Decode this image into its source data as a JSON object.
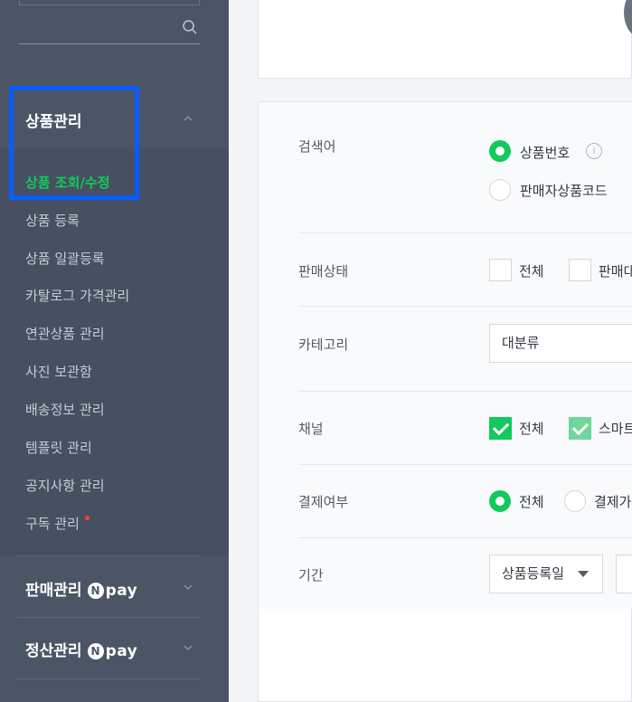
{
  "sidebar": {
    "sections": [
      {
        "title": "상품관리",
        "expanded": true,
        "items": [
          {
            "label": "상품 조회/수정",
            "active": true
          },
          {
            "label": "상품 등록"
          },
          {
            "label": "상품 일괄등록"
          },
          {
            "label": "카탈로그 가격관리"
          },
          {
            "label": "연관상품 관리"
          },
          {
            "label": "사진 보관함"
          },
          {
            "label": "배송정보 관리"
          },
          {
            "label": "템플릿 관리"
          },
          {
            "label": "공지사항 관리"
          },
          {
            "label": "구독 관리",
            "badge": "red-dot"
          }
        ]
      },
      {
        "title": "판매관리",
        "badge_n": "N",
        "badge_text": "pay",
        "expanded": false
      },
      {
        "title": "정산관리",
        "badge_n": "N",
        "badge_text": "pay",
        "expanded": false
      }
    ]
  },
  "form": {
    "search_term": {
      "label": "검색어",
      "options": [
        {
          "label": "상품번호",
          "selected": true,
          "info_icon": "i"
        },
        {
          "label": "판매자상품코드",
          "selected": false
        }
      ]
    },
    "sale_status": {
      "label": "판매상태",
      "options": [
        {
          "label": "전체",
          "checked": false
        },
        {
          "label": "판매대",
          "checked": false
        }
      ]
    },
    "category": {
      "label": "카테고리",
      "select_value": "대분류"
    },
    "channel": {
      "label": "채널",
      "options": [
        {
          "label": "전체",
          "checked": true
        },
        {
          "label": "스마트",
          "checked": true
        }
      ]
    },
    "payment": {
      "label": "결제여부",
      "options": [
        {
          "label": "전체",
          "selected": true
        },
        {
          "label": "결제가",
          "selected": false
        }
      ]
    },
    "period": {
      "label": "기간",
      "select_value": "상품등록일"
    }
  },
  "colors": {
    "sidebar_bg": "#4c5565",
    "accent_green": "#12c95b",
    "highlight_blue": "#0a5cff"
  }
}
